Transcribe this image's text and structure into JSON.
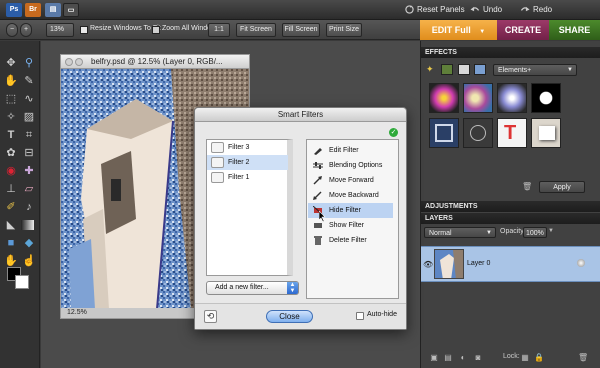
{
  "menubar": {
    "buttons": [
      "Reset Panels",
      "Undo",
      "Redo"
    ]
  },
  "options": {
    "zoom_value": "13%",
    "resize_windows": "Resize Windows To Fit",
    "zoom_all": "Zoom All Windows",
    "one_to_one": "1:1",
    "fit_screen": "Fit Screen",
    "fill_screen": "Fill Screen",
    "print_size": "Print Size"
  },
  "mode_tabs": [
    "EDIT Full",
    "CREATE",
    "SHARE"
  ],
  "document": {
    "title": "belfry.psd @ 12.5% (Layer 0, RGB/...",
    "zoom": "12.5%"
  },
  "dialog": {
    "title": "Smart Filters",
    "filters": [
      "Filter 3",
      "Filter 2",
      "Filter 1"
    ],
    "selected_filter": "Filter 2",
    "add_filter": "Add a new filter...",
    "actions": [
      "Edit Filter",
      "Blending Options",
      "Move Forward",
      "Move Backward",
      "Hide Filter",
      "Show Filter",
      "Delete Filter"
    ],
    "highlighted_action": "Hide Filter",
    "close": "Close",
    "autohide": "Auto-hide"
  },
  "effects": {
    "header": "EFFECTS",
    "category": "Elements+",
    "apply": "Apply"
  },
  "adjustments": {
    "header": "ADJUSTMENTS"
  },
  "layers": {
    "header": "LAYERS",
    "blend_mode": "Normal",
    "opacity_label": "Opacity:",
    "opacity_value": "100%",
    "layer_name": "Layer 0",
    "lock_label": "Lock:"
  },
  "colors": {
    "edit_tab": "#f0a030",
    "create_tab": "#8a2d5a",
    "share_tab": "#3a6e22",
    "selection": "#cfe0f6",
    "hover": "#bcd3f2"
  }
}
